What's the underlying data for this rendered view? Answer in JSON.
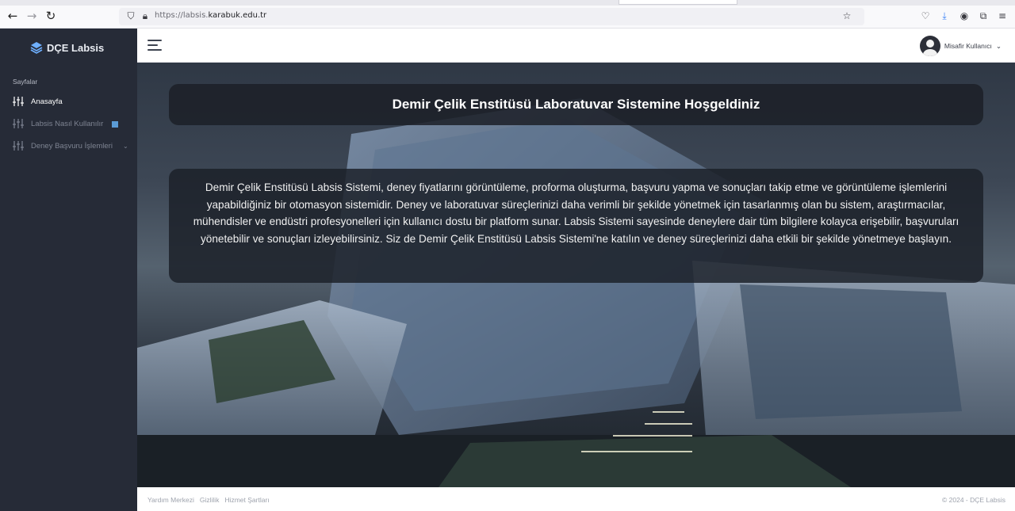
{
  "browser": {
    "url_prefix": "https://labsis.",
    "url_domain": "karabuk.edu.tr"
  },
  "sidebar": {
    "brand": "DÇE Labsis",
    "heading": "Sayfalar",
    "items": [
      {
        "label": "Anasayfa",
        "icon": "sliders-icon",
        "active": true
      },
      {
        "label": "Labsis Nasıl Kullanılır",
        "icon": "sliders-icon",
        "badge": "play-icon"
      },
      {
        "label": "Deney Başvuru İşlemleri",
        "icon": "sliders-icon",
        "chevron": "chevron-down-icon"
      }
    ]
  },
  "header": {
    "user_name": "Misafir Kullanıcı",
    "user_chevron": "⌄"
  },
  "main": {
    "title": "Demir Çelik Enstitüsü Laboratuvar Sistemine Hoşgeldiniz",
    "description": "Demir Çelik Enstitüsü Labsis Sistemi, deney fiyatlarını görüntüleme, proforma oluşturma, başvuru yapma ve sonuçları takip etme ve görüntüleme işlemlerini yapabildiğiniz bir otomasyon sistemidir. Deney ve laboratuvar süreçlerinizi daha verimli bir şekilde yönetmek için tasarlanmış olan bu sistem, araştırmacılar, mühendisler ve endüstri profesyonelleri için kullanıcı dostu bir platform sunar. Labsis Sistemi sayesinde deneylere dair tüm bilgilere kolayca erişebilir, başvuruları yönetebilir ve sonuçları izleyebilirsiniz. Siz de Demir Çelik Enstitüsü Labsis Sistemi'ne katılın ve deney süreçlerinizi daha etkili bir şekilde yönetmeye başlayın."
  },
  "footer": {
    "links": [
      "Yardım Merkezi",
      "Gizlilik",
      "Hizmet Şartları"
    ],
    "copyright": "© 2024 - DÇE Labsis"
  },
  "colors": {
    "sidebar_bg": "#262b37",
    "card_bg": "rgba(28,32,40,0.86)",
    "accent": "#5b9bd5"
  }
}
